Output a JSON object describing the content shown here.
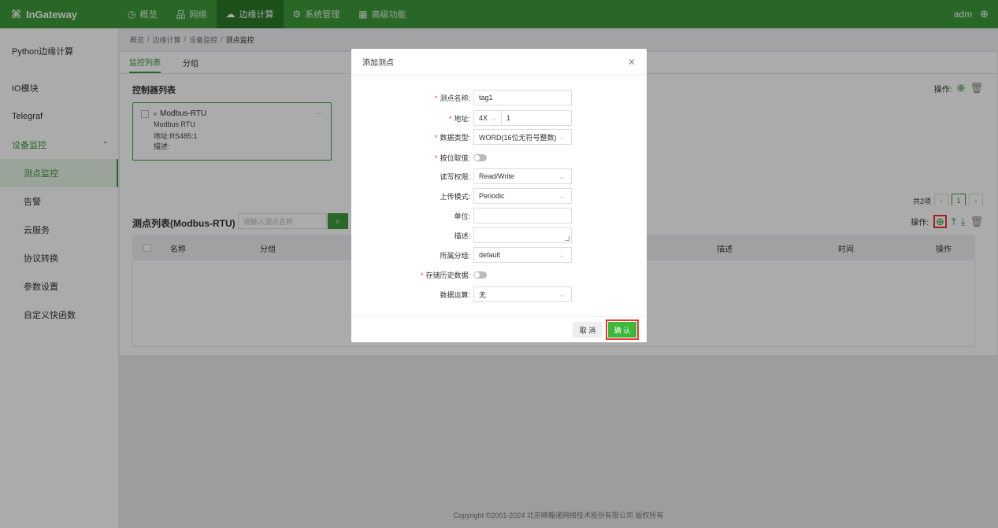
{
  "topbar": {
    "logo": "InGateway",
    "nav": [
      {
        "label": "概览",
        "icon": "dashboard-icon",
        "glyph": "◷"
      },
      {
        "label": "网络",
        "icon": "network-icon",
        "glyph": "品"
      },
      {
        "label": "边缘计算",
        "icon": "cloud-icon",
        "glyph": "☁"
      },
      {
        "label": "系统管理",
        "icon": "gear-icon",
        "glyph": "⚙"
      },
      {
        "label": "高级功能",
        "icon": "grid-icon",
        "glyph": "▦"
      }
    ],
    "active_nav": 2,
    "user": "adm",
    "accent": "#3c9a3a"
  },
  "sidebar": {
    "items": [
      {
        "label": "Python边缘计算"
      },
      {
        "label": "IO模块"
      },
      {
        "label": "Telegraf"
      },
      {
        "label": "设备监控"
      },
      {
        "label": "测点监控"
      },
      {
        "label": "告警"
      },
      {
        "label": "云服务"
      },
      {
        "label": "协议转换"
      },
      {
        "label": "参数设置"
      },
      {
        "label": "自定义快函数"
      }
    ]
  },
  "breadcrumb": [
    "概览",
    "边缘计算",
    "设备监控",
    "测点监控"
  ],
  "card1": {
    "tabs": [
      "监控列表",
      "分组"
    ],
    "section_title": "控制器列表",
    "ops_label": "操作:",
    "controller": {
      "name": "Modbus-RTU",
      "protocol": "Modbus RTU",
      "address": "地址:RS485:1",
      "desc": "描述:"
    },
    "pager_total": "共2项",
    "pager_page": "1"
  },
  "card2": {
    "title": "测点列表(Modbus-RTU)",
    "search_placeholder": "请输入测点名称",
    "ops_label": "操作:",
    "columns": [
      "名称",
      "分组",
      "描述",
      "时间",
      "操作"
    ]
  },
  "footer": "Copyright ©2001-2024 北京映翰通网络技术股份有限公司 版权所有",
  "modal": {
    "title": "添加测点",
    "fields": {
      "name_label": "测点名称:",
      "name_value": "tag1",
      "addr_label": "地址:",
      "addr_type": "4X",
      "addr_value": "1",
      "dtype_label": "数据类型:",
      "dtype_value": "WORD(16位无符号整数)",
      "bit_label": "按位取值:",
      "rw_label": "读写权限:",
      "rw_value": "Read/Write",
      "upload_label": "上传模式:",
      "upload_value": "Periodic",
      "unit_label": "单位:",
      "desc_label": "描述:",
      "group_label": "所属分组:",
      "group_value": "default",
      "history_label": "存储历史数据:",
      "calc_label": "数据运算:",
      "calc_value": "无"
    },
    "cancel": "取 消",
    "confirm": "确 认"
  }
}
